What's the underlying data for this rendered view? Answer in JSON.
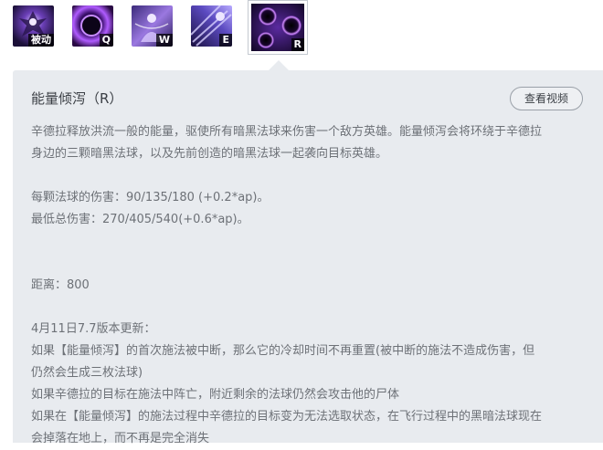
{
  "skills": [
    {
      "key": "被动",
      "icon": "passive-skill-icon"
    },
    {
      "key": "Q",
      "icon": "q-skill-icon"
    },
    {
      "key": "W",
      "icon": "w-skill-icon"
    },
    {
      "key": "E",
      "icon": "e-skill-icon"
    },
    {
      "key": "R",
      "icon": "r-skill-icon",
      "selected": true
    }
  ],
  "detail": {
    "title": "能量倾泻（R）",
    "video_button": "查看视频",
    "description_1": "辛德拉释放洪流一般的能量，驱使所有暗黑法球来伤害一个敌方英雄。能量倾泻会将环绕于辛德拉",
    "description_2": "身边的三颗暗黑法球，以及先前创造的暗黑法球一起袭向目标英雄。",
    "damage_per_orb": "每颗法球的伤害：90/135/180 (+0.2*ap)。",
    "min_total_damage": "最低总伤害：270/405/540(+0.6*ap)。",
    "range": "距离：800",
    "patch_title": "4月11日7.7版本更新：",
    "patch_line_1a": "如果【能量倾泻】的首次施法被中断，那么它的冷却时间不再重置(被中断的施法不造成伤害，但",
    "patch_line_1b": "仍然会生成三枚法球)",
    "patch_line_2": "如果辛德拉的目标在施法中阵亡，附近剩余的法球仍然会攻击他的尸体",
    "patch_line_3a": "如果在【能量倾泻】的施法过程中辛德拉的目标变为无法选取状态，在飞行过程中的黑暗法球现在",
    "patch_line_3b": "会掉落在地上，而不再是完全消失"
  }
}
